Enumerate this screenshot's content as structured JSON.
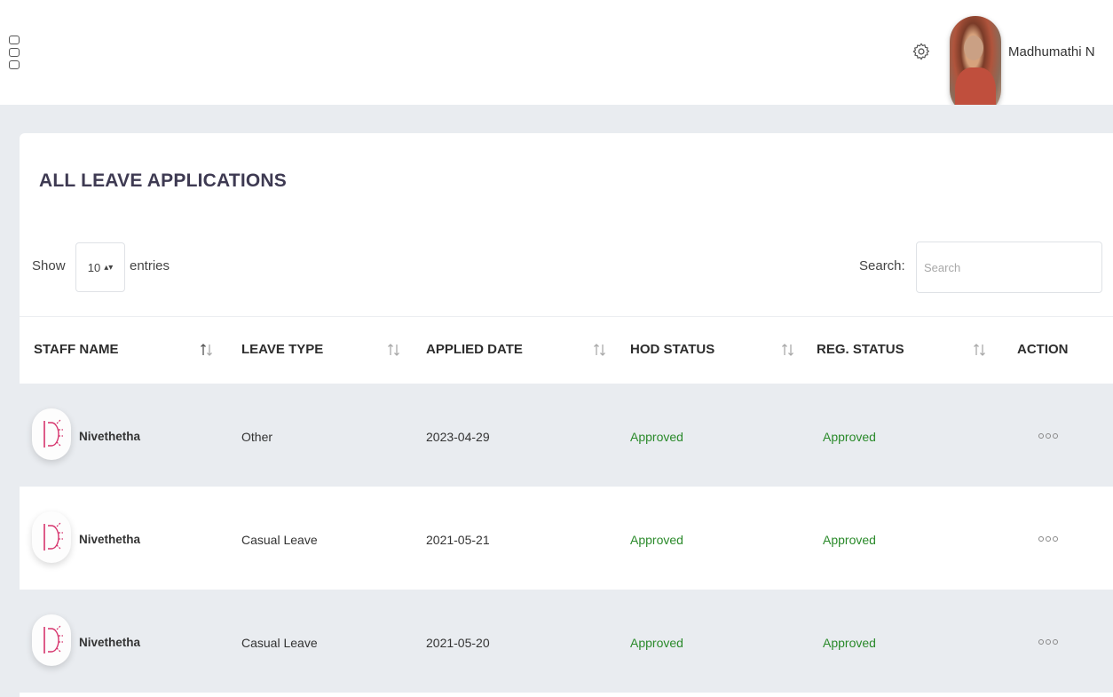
{
  "header": {
    "user_name": "Madhumathi N",
    "icons": {
      "menu": "grid-menu-icon",
      "settings": "gear-icon",
      "avatar": "user-avatar"
    }
  },
  "page": {
    "title": "ALL LEAVE APPLICATIONS"
  },
  "table_controls": {
    "show_label": "Show",
    "page_length": "10",
    "entries_label": "entries",
    "search_label": "Search:",
    "search_placeholder": "Search",
    "search_value": ""
  },
  "table": {
    "columns": [
      "STAFF NAME",
      "LEAVE TYPE",
      "APPLIED DATE",
      "HOD STATUS",
      "REG. STATUS",
      "ACTION"
    ],
    "rows": [
      {
        "staff_name": "Nivethetha",
        "leave_type": "Other",
        "applied_date": "2023-04-29",
        "hod_status": "Approved",
        "reg_status": "Approved"
      },
      {
        "staff_name": "Nivethetha",
        "leave_type": "Casual Leave",
        "applied_date": "2021-05-21",
        "hod_status": "Approved",
        "reg_status": "Approved"
      },
      {
        "staff_name": "Nivethetha",
        "leave_type": "Casual Leave",
        "applied_date": "2021-05-20",
        "hod_status": "Approved",
        "reg_status": "Approved"
      }
    ]
  },
  "colors": {
    "approved": "#2a8a2a",
    "title": "#3e3a52",
    "stripe": "#e9ecf0",
    "avatar_accent": "#d6336c"
  }
}
